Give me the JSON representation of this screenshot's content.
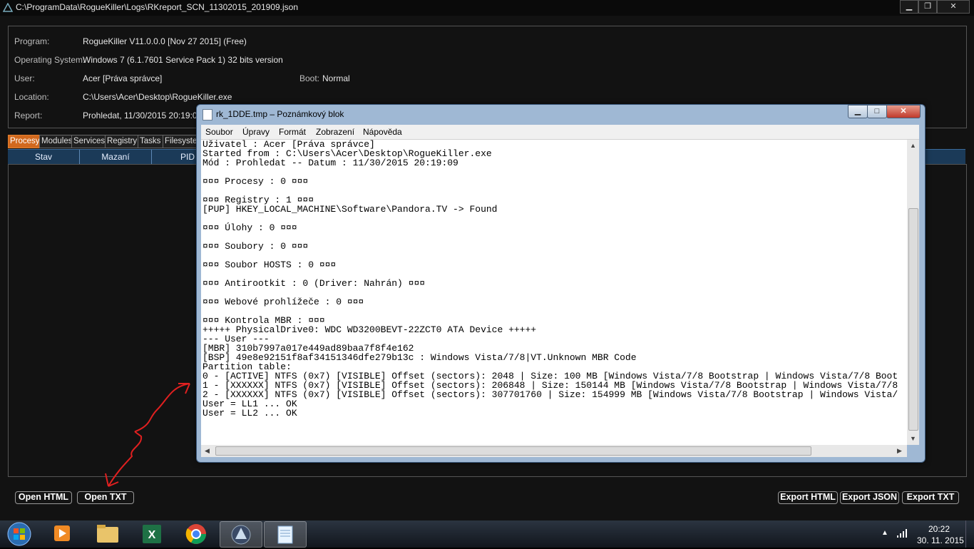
{
  "window": {
    "title": "C:\\ProgramData\\RogueKiller\\Logs\\RKreport_SCN_11302015_201909.json",
    "minimize": "▁",
    "maximize": "❐",
    "close": "✕"
  },
  "info": {
    "program_label": "Program:",
    "program_value": "RogueKiller V11.0.0.0 [Nov 27 2015] (Free)",
    "os_label": "Operating System:",
    "os_value": "Windows 7 (6.1.7601 Service Pack 1) 32 bits version",
    "user_label": "User:",
    "user_value": "Acer [Práva správce]",
    "boot_label": "Boot:",
    "boot_value": "Normal",
    "location_label": "Location:",
    "location_value": "C:\\Users\\Acer\\Desktop\\RogueKiller.exe",
    "report_label": "Report:",
    "report_value": "Prohledat, 11/30/2015 20:19:09"
  },
  "tabs": [
    "Procesy",
    "Modules",
    "Services",
    "Registry",
    "Tasks",
    "Filesystem"
  ],
  "columns": [
    "Stav",
    "Mazaní",
    "PID"
  ],
  "buttons": {
    "open_html": "Open HTML",
    "open_txt": "Open TXT",
    "export_html": "Export HTML",
    "export_json": "Export JSON",
    "export_txt": "Export TXT"
  },
  "notepad": {
    "title": "rk_1DDE.tmp – Poznámkový blok",
    "menu": [
      "Soubor",
      "Úpravy",
      "Formát",
      "Zobrazení",
      "Nápověda"
    ],
    "content": "Uživatel : Acer [Práva správce]\nStarted from : C:\\Users\\Acer\\Desktop\\RogueKiller.exe\nMód : Prohledat -- Datum : 11/30/2015 20:19:09\n\n¤¤¤ Procesy : 0 ¤¤¤\n\n¤¤¤ Registry : 1 ¤¤¤\n[PUP] HKEY_LOCAL_MACHINE\\Software\\Pandora.TV -> Found\n\n¤¤¤ Úlohy : 0 ¤¤¤\n\n¤¤¤ Soubory : 0 ¤¤¤\n\n¤¤¤ Soubor HOSTS : 0 ¤¤¤\n\n¤¤¤ Antirootkit : 0 (Driver: Nahrán) ¤¤¤\n\n¤¤¤ Webové prohlížeče : 0 ¤¤¤\n\n¤¤¤ Kontrola MBR : ¤¤¤\n+++++ PhysicalDrive0: WDC WD3200BEVT-22ZCT0 ATA Device +++++\n--- User ---\n[MBR] 310b7997a017e449ad89baa7f8f4e162\n[BSP] 49e8e92151f8af34151346dfe279b13c : Windows Vista/7/8|VT.Unknown MBR Code\nPartition table:\n0 - [ACTIVE] NTFS (0x7) [VISIBLE] Offset (sectors): 2048 | Size: 100 MB [Windows Vista/7/8 Bootstrap | Windows Vista/7/8 Boot\n1 - [XXXXXX] NTFS (0x7) [VISIBLE] Offset (sectors): 206848 | Size: 150144 MB [Windows Vista/7/8 Bootstrap | Windows Vista/7/8\n2 - [XXXXXX] NTFS (0x7) [VISIBLE] Offset (sectors): 307701760 | Size: 154999 MB [Windows Vista/7/8 Bootstrap | Windows Vista/\nUser = LL1 ... OK\nUser = LL2 ... OK"
  },
  "taskbar": {
    "time": "20:22",
    "date": "30. 11. 2015",
    "apps": [
      "start-orb",
      "media-player",
      "file-explorer",
      "excel",
      "chrome",
      "roguekiller",
      "notepad"
    ]
  },
  "colors": {
    "active_tab": "#d2691e",
    "header_blue": "#1b3a58",
    "annotation_red": "#e02020"
  }
}
